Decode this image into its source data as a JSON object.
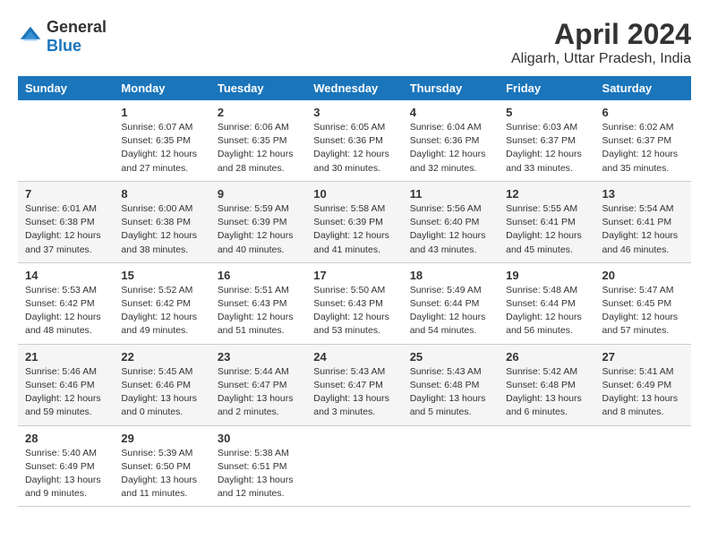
{
  "logo": {
    "general": "General",
    "blue": "Blue"
  },
  "title": "April 2024",
  "subtitle": "Aligarh, Uttar Pradesh, India",
  "weekdays": [
    "Sunday",
    "Monday",
    "Tuesday",
    "Wednesday",
    "Thursday",
    "Friday",
    "Saturday"
  ],
  "weeks": [
    [
      {
        "day": "",
        "info": ""
      },
      {
        "day": "1",
        "info": "Sunrise: 6:07 AM\nSunset: 6:35 PM\nDaylight: 12 hours\nand 27 minutes."
      },
      {
        "day": "2",
        "info": "Sunrise: 6:06 AM\nSunset: 6:35 PM\nDaylight: 12 hours\nand 28 minutes."
      },
      {
        "day": "3",
        "info": "Sunrise: 6:05 AM\nSunset: 6:36 PM\nDaylight: 12 hours\nand 30 minutes."
      },
      {
        "day": "4",
        "info": "Sunrise: 6:04 AM\nSunset: 6:36 PM\nDaylight: 12 hours\nand 32 minutes."
      },
      {
        "day": "5",
        "info": "Sunrise: 6:03 AM\nSunset: 6:37 PM\nDaylight: 12 hours\nand 33 minutes."
      },
      {
        "day": "6",
        "info": "Sunrise: 6:02 AM\nSunset: 6:37 PM\nDaylight: 12 hours\nand 35 minutes."
      }
    ],
    [
      {
        "day": "7",
        "info": "Sunrise: 6:01 AM\nSunset: 6:38 PM\nDaylight: 12 hours\nand 37 minutes."
      },
      {
        "day": "8",
        "info": "Sunrise: 6:00 AM\nSunset: 6:38 PM\nDaylight: 12 hours\nand 38 minutes."
      },
      {
        "day": "9",
        "info": "Sunrise: 5:59 AM\nSunset: 6:39 PM\nDaylight: 12 hours\nand 40 minutes."
      },
      {
        "day": "10",
        "info": "Sunrise: 5:58 AM\nSunset: 6:39 PM\nDaylight: 12 hours\nand 41 minutes."
      },
      {
        "day": "11",
        "info": "Sunrise: 5:56 AM\nSunset: 6:40 PM\nDaylight: 12 hours\nand 43 minutes."
      },
      {
        "day": "12",
        "info": "Sunrise: 5:55 AM\nSunset: 6:41 PM\nDaylight: 12 hours\nand 45 minutes."
      },
      {
        "day": "13",
        "info": "Sunrise: 5:54 AM\nSunset: 6:41 PM\nDaylight: 12 hours\nand 46 minutes."
      }
    ],
    [
      {
        "day": "14",
        "info": "Sunrise: 5:53 AM\nSunset: 6:42 PM\nDaylight: 12 hours\nand 48 minutes."
      },
      {
        "day": "15",
        "info": "Sunrise: 5:52 AM\nSunset: 6:42 PM\nDaylight: 12 hours\nand 49 minutes."
      },
      {
        "day": "16",
        "info": "Sunrise: 5:51 AM\nSunset: 6:43 PM\nDaylight: 12 hours\nand 51 minutes."
      },
      {
        "day": "17",
        "info": "Sunrise: 5:50 AM\nSunset: 6:43 PM\nDaylight: 12 hours\nand 53 minutes."
      },
      {
        "day": "18",
        "info": "Sunrise: 5:49 AM\nSunset: 6:44 PM\nDaylight: 12 hours\nand 54 minutes."
      },
      {
        "day": "19",
        "info": "Sunrise: 5:48 AM\nSunset: 6:44 PM\nDaylight: 12 hours\nand 56 minutes."
      },
      {
        "day": "20",
        "info": "Sunrise: 5:47 AM\nSunset: 6:45 PM\nDaylight: 12 hours\nand 57 minutes."
      }
    ],
    [
      {
        "day": "21",
        "info": "Sunrise: 5:46 AM\nSunset: 6:46 PM\nDaylight: 12 hours\nand 59 minutes."
      },
      {
        "day": "22",
        "info": "Sunrise: 5:45 AM\nSunset: 6:46 PM\nDaylight: 13 hours\nand 0 minutes."
      },
      {
        "day": "23",
        "info": "Sunrise: 5:44 AM\nSunset: 6:47 PM\nDaylight: 13 hours\nand 2 minutes."
      },
      {
        "day": "24",
        "info": "Sunrise: 5:43 AM\nSunset: 6:47 PM\nDaylight: 13 hours\nand 3 minutes."
      },
      {
        "day": "25",
        "info": "Sunrise: 5:43 AM\nSunset: 6:48 PM\nDaylight: 13 hours\nand 5 minutes."
      },
      {
        "day": "26",
        "info": "Sunrise: 5:42 AM\nSunset: 6:48 PM\nDaylight: 13 hours\nand 6 minutes."
      },
      {
        "day": "27",
        "info": "Sunrise: 5:41 AM\nSunset: 6:49 PM\nDaylight: 13 hours\nand 8 minutes."
      }
    ],
    [
      {
        "day": "28",
        "info": "Sunrise: 5:40 AM\nSunset: 6:49 PM\nDaylight: 13 hours\nand 9 minutes."
      },
      {
        "day": "29",
        "info": "Sunrise: 5:39 AM\nSunset: 6:50 PM\nDaylight: 13 hours\nand 11 minutes."
      },
      {
        "day": "30",
        "info": "Sunrise: 5:38 AM\nSunset: 6:51 PM\nDaylight: 13 hours\nand 12 minutes."
      },
      {
        "day": "",
        "info": ""
      },
      {
        "day": "",
        "info": ""
      },
      {
        "day": "",
        "info": ""
      },
      {
        "day": "",
        "info": ""
      }
    ]
  ]
}
